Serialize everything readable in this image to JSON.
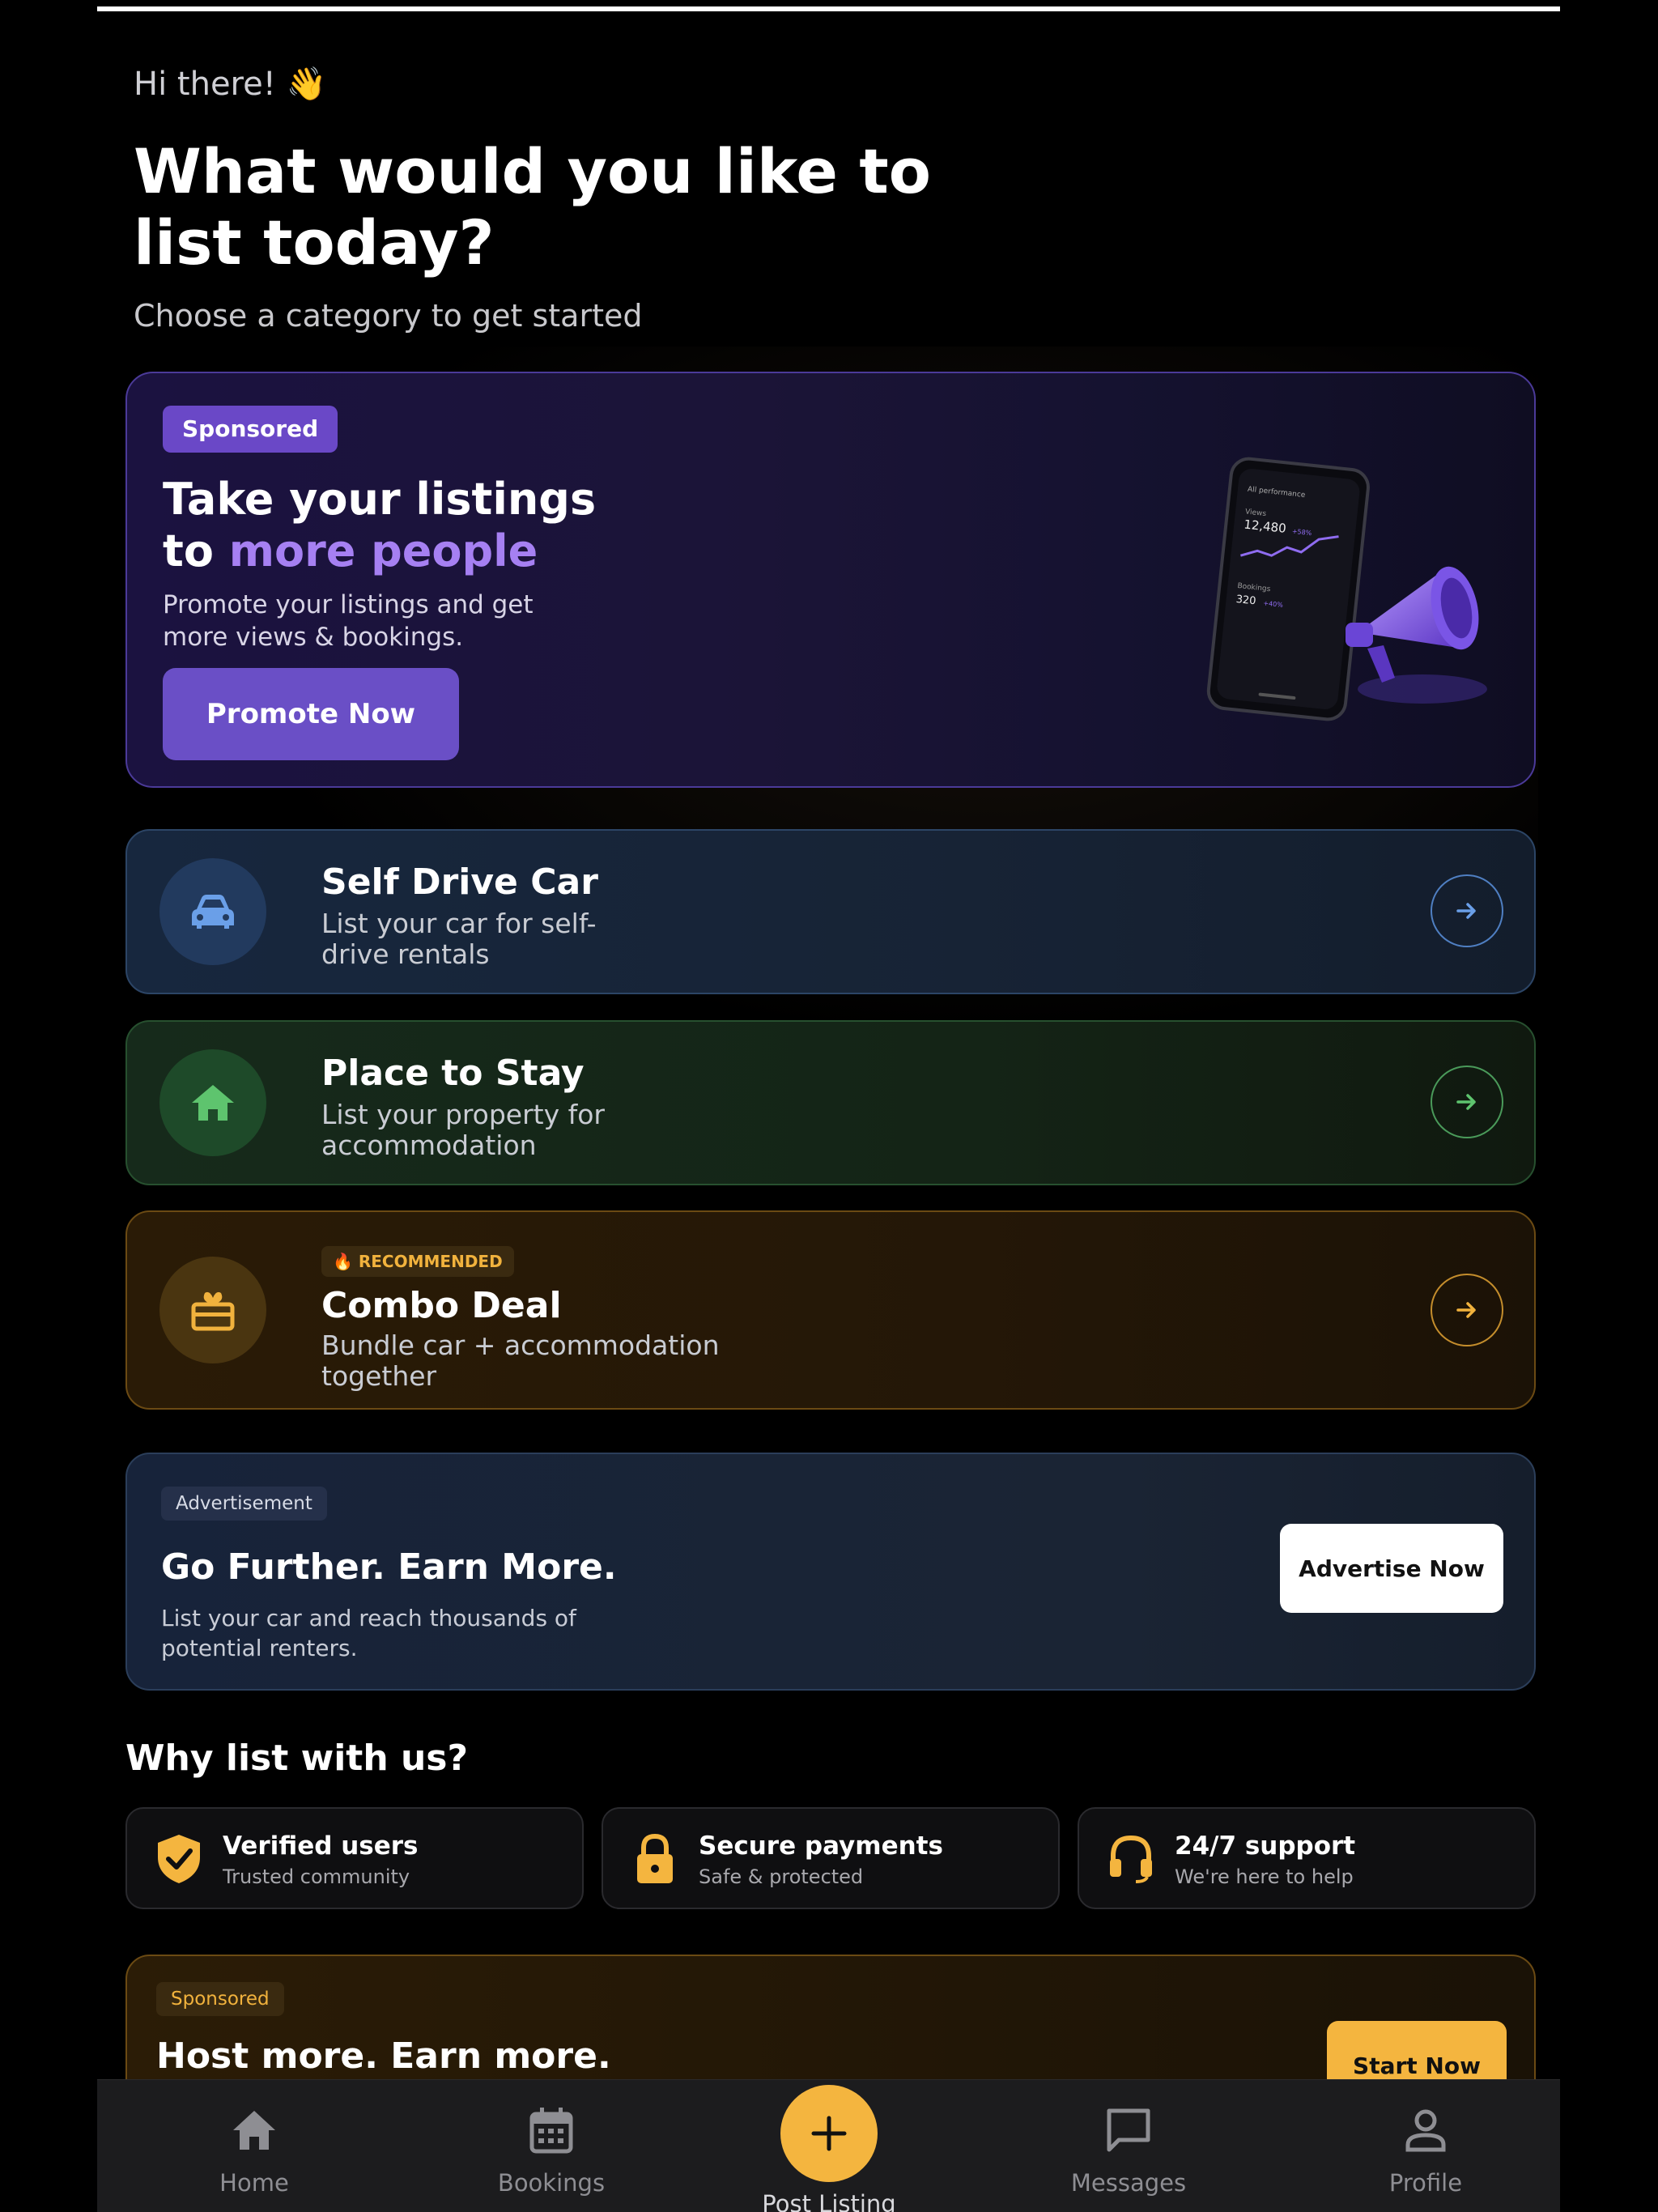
{
  "greeting": "Hi there! 👋",
  "headline": "What would you like to list today?",
  "subheadline": "Choose a category to get started",
  "promo": {
    "badge": "Sponsored",
    "title_line1": "Take your listings",
    "title_prefix": "to ",
    "title_accent": "more people",
    "description": "Promote your listings and get more views & bookings.",
    "button": "Promote Now",
    "phone_header": "All performance",
    "phone_views_label": "Views",
    "phone_views_value": "12,480",
    "phone_views_change": "+58%",
    "phone_bookings_label": "Bookings",
    "phone_bookings_value": "320",
    "phone_bookings_change": "+40%",
    "accent_color": "#a680f2"
  },
  "categories": [
    {
      "title": "Self Drive Car",
      "description": "List your car for self-drive rentals",
      "icon": "car-icon",
      "color": "#6a9fe8"
    },
    {
      "title": "Place to Stay",
      "description": "List your property for accommodation",
      "icon": "house-icon",
      "color": "#5ec46e"
    },
    {
      "title": "Combo Deal",
      "description": "Bundle car + accommodation together",
      "icon": "gift-icon",
      "badge": "🔥 RECOMMENDED",
      "color": "#f1b23d"
    }
  ],
  "ad": {
    "badge": "Advertisement",
    "title": "Go Further. Earn More.",
    "description": "List your car and reach thousands of potential renters.",
    "button": "Advertise Now"
  },
  "why": {
    "title": "Why list with us?",
    "features": [
      {
        "title": "Verified users",
        "subtitle": "Trusted community",
        "icon": "shield-check-icon"
      },
      {
        "title": "Secure payments",
        "subtitle": "Safe & protected",
        "icon": "lock-icon"
      },
      {
        "title": "24/7 support",
        "subtitle": "We're here to help",
        "icon": "headset-icon"
      }
    ]
  },
  "host": {
    "badge": "Sponsored",
    "title": "Host more. Earn more.",
    "button": "Start Now"
  },
  "nav": {
    "items": [
      {
        "label": "Home",
        "icon": "home-icon"
      },
      {
        "label": "Bookings",
        "icon": "calendar-icon"
      },
      {
        "label": "Post Listing",
        "icon": "plus-icon"
      },
      {
        "label": "Messages",
        "icon": "message-icon"
      },
      {
        "label": "Profile",
        "icon": "profile-icon"
      }
    ]
  }
}
